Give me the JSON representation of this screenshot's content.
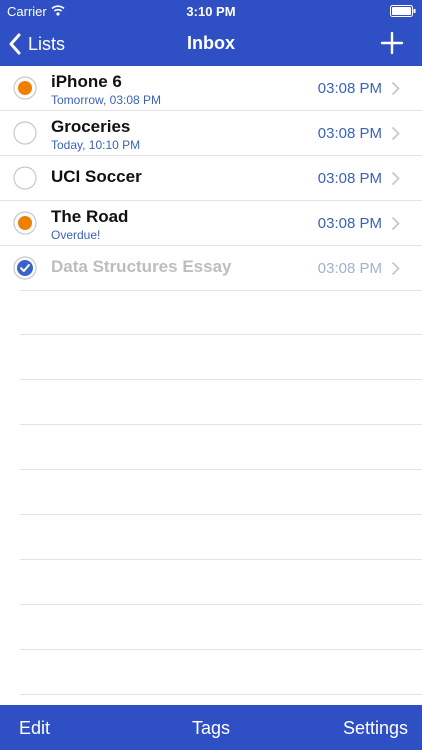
{
  "status_bar": {
    "carrier": "Carrier",
    "time": "3:10 PM"
  },
  "nav": {
    "back_label": "Lists",
    "title": "Inbox",
    "add_icon": "plus-icon"
  },
  "tasks": [
    {
      "title": "iPhone 6",
      "subtitle": "Tomorrow, 03:08 PM",
      "time": "03:08 PM",
      "status": "priority"
    },
    {
      "title": "Groceries",
      "subtitle": "Today, 10:10 PM",
      "time": "03:08 PM",
      "status": "open"
    },
    {
      "title": "UCI Soccer",
      "subtitle": "",
      "time": "03:08 PM",
      "status": "open"
    },
    {
      "title": "The Road",
      "subtitle": "Overdue!",
      "time": "03:08 PM",
      "status": "priority"
    },
    {
      "title": "Data Structures Essay",
      "subtitle": "",
      "time": "03:08 PM",
      "status": "completed"
    }
  ],
  "toolbar": {
    "edit_label": "Edit",
    "tags_label": "Tags",
    "settings_label": "Settings"
  },
  "colors": {
    "bar_blue": "#2f4fc4",
    "priority_orange": "#f07f00",
    "link_blue": "#3a63b8"
  }
}
